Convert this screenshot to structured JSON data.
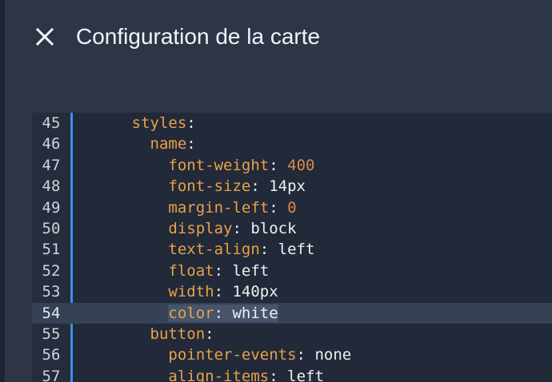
{
  "dialog": {
    "title": "Configuration de la carte",
    "close_icon": "close-icon"
  },
  "editor": {
    "active_line": 54,
    "lines": [
      {
        "num": "45",
        "indent": "      ",
        "key": "styles",
        "value": "",
        "vtype": "none"
      },
      {
        "num": "46",
        "indent": "        ",
        "key": "name",
        "value": "",
        "vtype": "none"
      },
      {
        "num": "47",
        "indent": "          ",
        "key": "font-weight",
        "value": "400",
        "vtype": "num"
      },
      {
        "num": "48",
        "indent": "          ",
        "key": "font-size",
        "value": "14px",
        "vtype": "str"
      },
      {
        "num": "49",
        "indent": "          ",
        "key": "margin-left",
        "value": "0",
        "vtype": "num"
      },
      {
        "num": "50",
        "indent": "          ",
        "key": "display",
        "value": "block",
        "vtype": "str"
      },
      {
        "num": "51",
        "indent": "          ",
        "key": "text-align",
        "value": "left",
        "vtype": "str"
      },
      {
        "num": "52",
        "indent": "          ",
        "key": "float",
        "value": "left",
        "vtype": "str"
      },
      {
        "num": "53",
        "indent": "          ",
        "key": "width",
        "value": "140px",
        "vtype": "str"
      },
      {
        "num": "54",
        "indent": "          ",
        "key": "color",
        "value": "white",
        "vtype": "str"
      },
      {
        "num": "55",
        "indent": "        ",
        "key": "button",
        "value": "",
        "vtype": "none"
      },
      {
        "num": "56",
        "indent": "          ",
        "key": "pointer-events",
        "value": "none",
        "vtype": "str"
      },
      {
        "num": "57",
        "indent": "          ",
        "key": "align-items",
        "value": "left",
        "vtype": "str"
      }
    ]
  },
  "colors": {
    "key": "#e8a24a",
    "number": "#d9884d",
    "string": "#eef0f3",
    "gutter_accent": "#3d8fe8",
    "background": "#2d3546"
  }
}
